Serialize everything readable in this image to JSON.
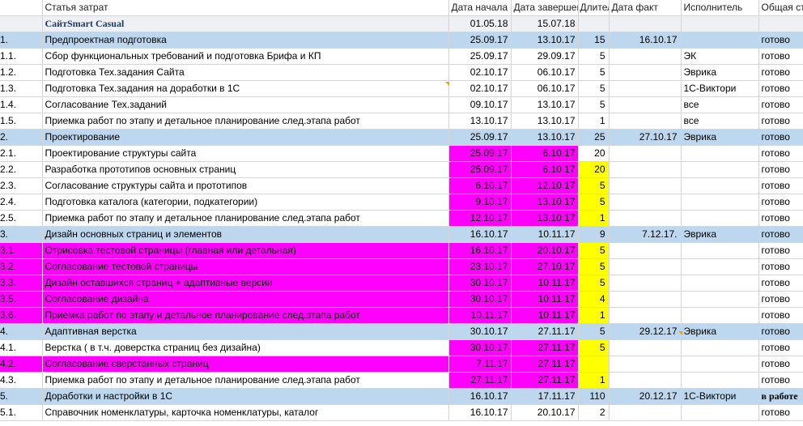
{
  "header": {
    "num": "",
    "name": "Статья затрат",
    "start": "Дата начала",
    "end": "Дата завершения",
    "dur": "Длительность",
    "fact": "Дата факт",
    "exec": "Исполнитель",
    "status": "Общая стоимость"
  },
  "rows": [
    {
      "num": "",
      "name": "СайтSmart Casual",
      "start": "01.05.18",
      "end": "15.07.18",
      "dur": "",
      "fact": "",
      "exec": "",
      "status": ""
    },
    {
      "num": "1.",
      "name": "Предпроектная подготовка",
      "start": "25.09.17",
      "end": "13.10.17",
      "dur": "15",
      "fact": "16.10.17",
      "exec": "",
      "status": "готово"
    },
    {
      "num": "1.1.",
      "name": "Сбор функциональных требований и подготовка Брифа и КП",
      "start": "25.09.17",
      "end": "29.09.17",
      "dur": "5",
      "fact": "",
      "exec": "ЭК",
      "status": "готово"
    },
    {
      "num": "1.2.",
      "name": "Подготовка Тех.задания Сайта",
      "start": "02.10.17",
      "end": "06.10.17",
      "dur": "5",
      "fact": "",
      "exec": "Эврика",
      "status": "готово"
    },
    {
      "num": "1.3.",
      "name": "Подготовка Тех.задания на доработки в 1С",
      "start": "02.10.17",
      "end": "06.10.17",
      "dur": "5",
      "fact": "",
      "exec": "1С-Виктори",
      "status": "готово"
    },
    {
      "num": "1.4.",
      "name": "Согласование Тех.заданий",
      "start": "09.10.17",
      "end": "13.10.17",
      "dur": "5",
      "fact": "",
      "exec": "все",
      "status": "готово"
    },
    {
      "num": "1.5.",
      "name": "Приемка работ по этапу и детальное планирование след.этапа работ",
      "start": "13.10.17",
      "end": "13.10.17",
      "dur": "1",
      "fact": "",
      "exec": "все",
      "status": "готово"
    },
    {
      "num": "2.",
      "name": "Проектирование",
      "start": "25.09.17",
      "end": "13.10.17",
      "dur": "25",
      "fact": "27.10.17",
      "exec": "Эврика",
      "status": "готово"
    },
    {
      "num": "2.1.",
      "name": "Проектирование структуры сайта",
      "start": "25.09.17",
      "end": "6.10.17",
      "dur": "20",
      "fact": "",
      "exec": "",
      "status": "готово"
    },
    {
      "num": "2.2.",
      "name": "Разработка прототипов основных страниц",
      "start": "25.09.17",
      "end": "6.10.17",
      "dur": "20",
      "fact": "",
      "exec": "",
      "status": "готово"
    },
    {
      "num": "2.3.",
      "name": "Согласование структуры сайта и прототипов",
      "start": "6.10.17",
      "end": "12.10.17",
      "dur": "5",
      "fact": "",
      "exec": "",
      "status": "готово"
    },
    {
      "num": "2.4.",
      "name": "Подготовка каталога (категории, подкатегории)",
      "start": "9.10.17",
      "end": "13.10.17",
      "dur": "5",
      "fact": "",
      "exec": "",
      "status": "готово"
    },
    {
      "num": "2.5.",
      "name": "Приемка работ по этапу и детальное планирование след.этапа работ",
      "start": "12.10.17",
      "end": "13.10.17",
      "dur": "1",
      "fact": "",
      "exec": "",
      "status": "готово"
    },
    {
      "num": "3.",
      "name": "Дизайн основных страниц и элементов",
      "start": "16.10.17",
      "end": "10.11.17",
      "dur": "9",
      "fact": "7.12.17.",
      "exec": "Эврика",
      "status": "готово"
    },
    {
      "num": "3.1.",
      "name": "Отрисовка тестовой страницы (главная или детальная)",
      "start": "16.10.17",
      "end": "20.10.17",
      "dur": "5",
      "fact": "",
      "exec": "",
      "status": "готово"
    },
    {
      "num": "3.2.",
      "name": "Согласование тестовой страницы",
      "start": "23.10.17",
      "end": "27.10.17",
      "dur": "5",
      "fact": "",
      "exec": "",
      "status": "готово"
    },
    {
      "num": "3.3.",
      "name": "Дизайн оставшихся страниц + адаптивные версии",
      "start": "30.10.17",
      "end": "10.11.17",
      "dur": "5",
      "fact": "",
      "exec": "",
      "status": "готово"
    },
    {
      "num": "3.5.",
      "name": "Согласование дизайна",
      "start": "30.10.17",
      "end": "10.11.17",
      "dur": "4",
      "fact": "",
      "exec": "",
      "status": "готово"
    },
    {
      "num": "3.6.",
      "name": "Приемка работ по этапу и детальное планирование след.этапа работ",
      "start": "10.11.17",
      "end": "10.11.17",
      "dur": "1",
      "fact": "",
      "exec": "",
      "status": "готово"
    },
    {
      "num": "4.",
      "name": "Адаптивная верстка",
      "start": "30.10.17",
      "end": "27.11.17",
      "dur": "5",
      "fact": "29.12.17",
      "exec": "Эврика",
      "status": "готово"
    },
    {
      "num": "4.1.",
      "name": "Верстка ( в т.ч.  доверстка страниц без дизайна)",
      "start": "30.10.17",
      "end": "27.11.17",
      "dur": "5",
      "fact": "",
      "exec": "",
      "status": "готово"
    },
    {
      "num": "4.2.",
      "name": "Согласование сверстанных страниц",
      "start": "7.11.17",
      "end": "27.11.17",
      "dur": "",
      "fact": "",
      "exec": "",
      "status": "готово"
    },
    {
      "num": "4.3.",
      "name": "Приемка работ по этапу и детальное планирование след.этапа работ",
      "start": "27.11.17",
      "end": "27.11.17",
      "dur": "1",
      "fact": "",
      "exec": "",
      "status": "готово"
    },
    {
      "num": "5.",
      "name": "Доработки и настройки в 1С",
      "start": "16.10.17",
      "end": "17.11.17",
      "dur": "110",
      "fact": "20.12.17",
      "exec": "1С-Виктори",
      "status": "в работе"
    },
    {
      "num": "5.1.",
      "name": "Справочник номенклатуры, карточка номенклатуры, каталог",
      "start": "16.10.17",
      "end": "20.10.17",
      "dur": "2",
      "fact": "",
      "exec": "",
      "status": "готово"
    }
  ],
  "colors": {
    "group": "#bdd7ee",
    "magenta": "#ff00ff",
    "yellow": "#ffff00",
    "title": "#eef0f3"
  }
}
